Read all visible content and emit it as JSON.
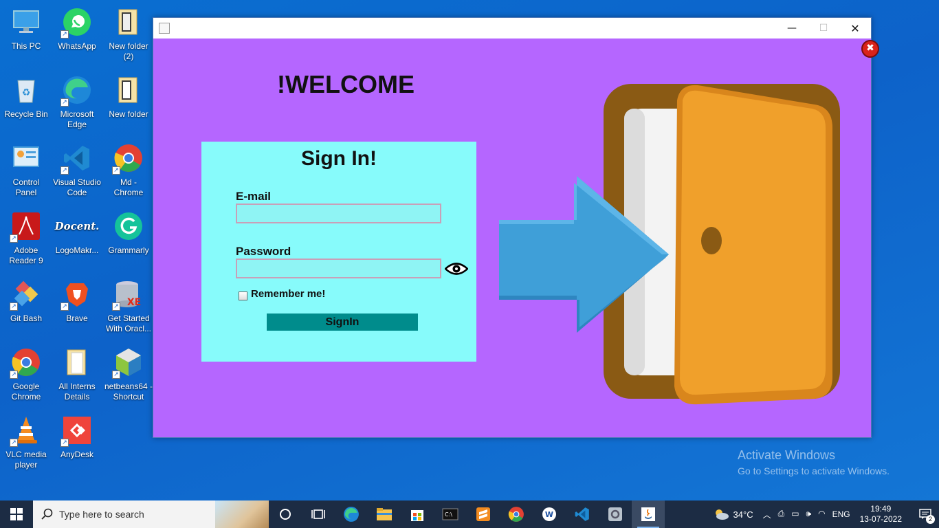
{
  "desktop": {
    "icons": [
      {
        "label": "This PC"
      },
      {
        "label": "WhatsApp"
      },
      {
        "label": "New folder\n(2)"
      },
      {
        "label": "Recycle Bin"
      },
      {
        "label": "Microsoft\nEdge"
      },
      {
        "label": "New folder"
      },
      {
        "label": "Control\nPanel"
      },
      {
        "label": "Visual Studio\nCode"
      },
      {
        "label": "Md -\nChrome"
      },
      {
        "label": "Adobe\nReader 9"
      },
      {
        "label": "LogoMakr..."
      },
      {
        "label": "Grammarly"
      },
      {
        "label": "Git Bash"
      },
      {
        "label": "Brave"
      },
      {
        "label": "Get Started\nWith Oracl..."
      },
      {
        "label": "Google\nChrome"
      },
      {
        "label": "All Interns\nDetails"
      },
      {
        "label": "netbeans64 -\nShortcut"
      },
      {
        "label": "VLC media\nplayer"
      },
      {
        "label": "AnyDesk"
      }
    ],
    "logomakr_text": "Docent."
  },
  "window": {
    "minimize": "—",
    "maximize": "☐",
    "close": "✕"
  },
  "app": {
    "welcome": "!WELCOME",
    "signin_title": "Sign In!",
    "email_label": "E-mail",
    "email_value": "",
    "password_label": "Password",
    "password_value": "",
    "remember_label": "Remember me!",
    "remember_checked": false,
    "signin_button": "SignIn",
    "colors": {
      "background": "#b566ff",
      "panel": "#87fbfb",
      "button": "#008c8c"
    }
  },
  "watermark": {
    "line1": "Activate Windows",
    "line2": "Go to Settings to activate Windows."
  },
  "taskbar": {
    "search_placeholder": "Type here to search",
    "temperature": "34°C",
    "language": "ENG",
    "time": "19:49",
    "date": "13-07-2022",
    "notification_count": "2"
  }
}
